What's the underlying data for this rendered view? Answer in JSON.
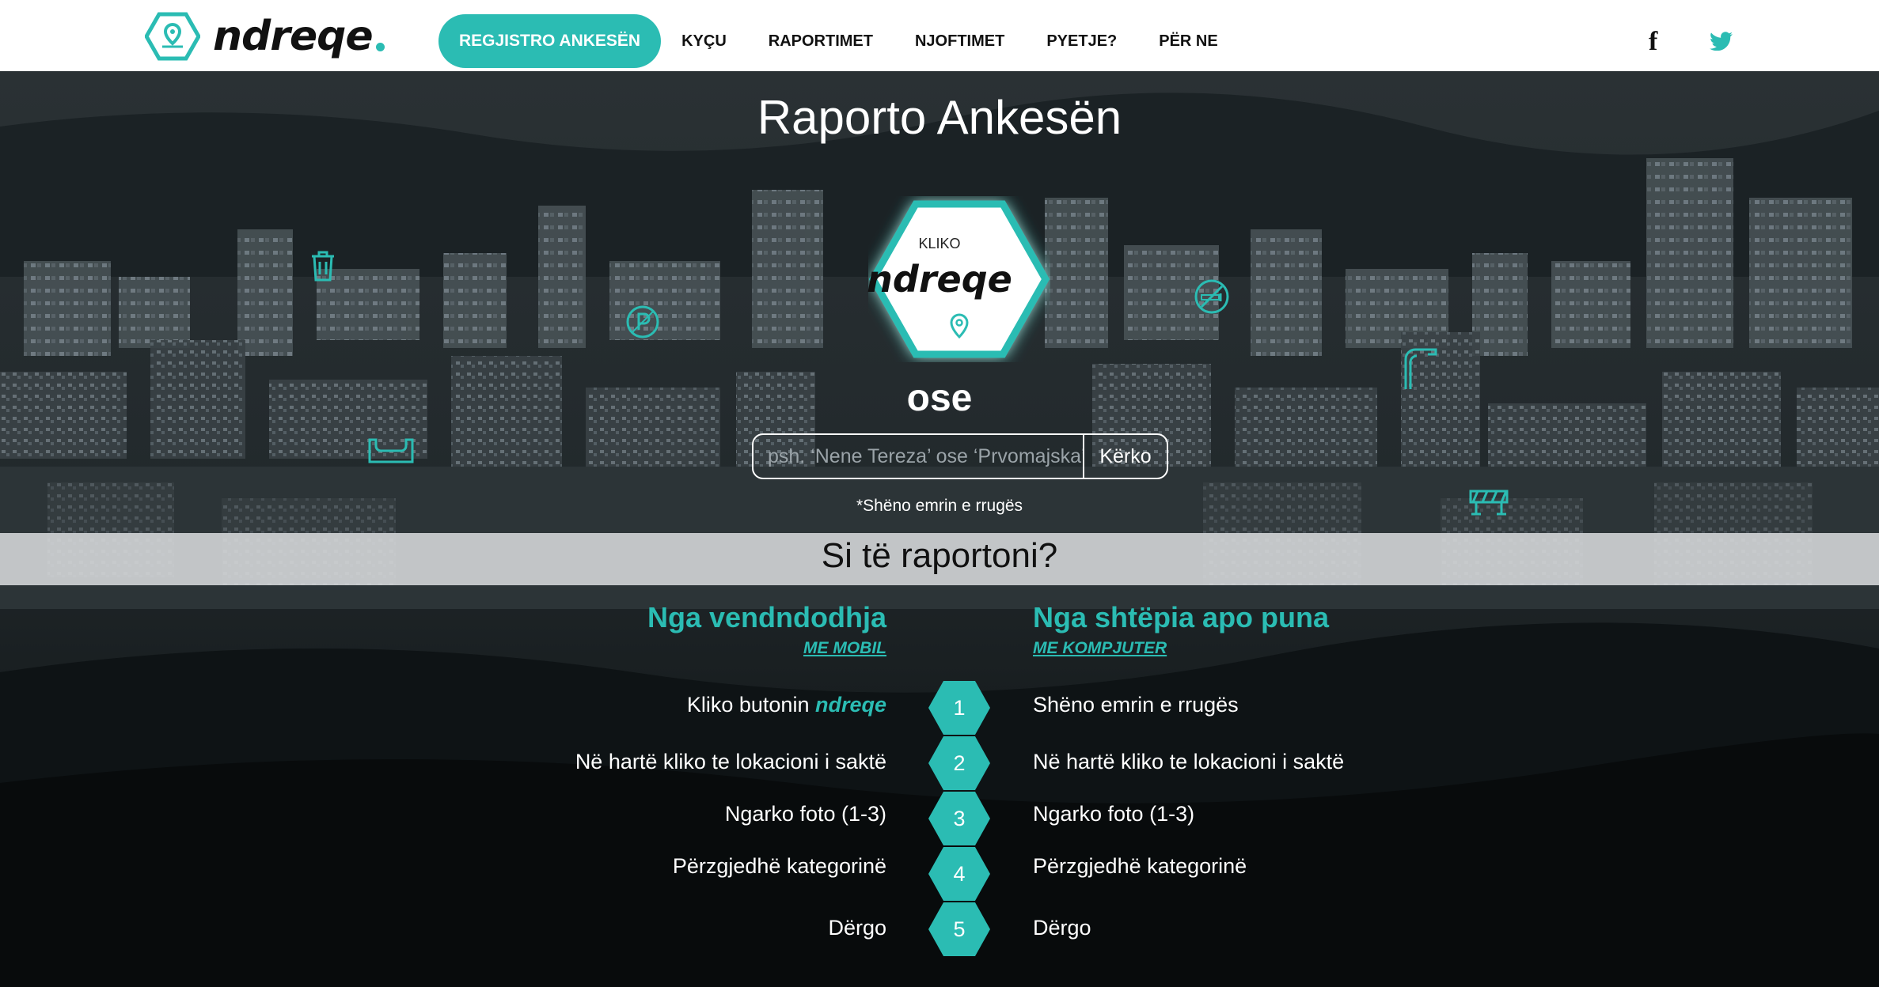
{
  "brand": {
    "name": "ndreqe",
    "accent": "#2bbcb3"
  },
  "nav": {
    "primary_label": "REGJISTRO ANKESËN",
    "items": [
      "KYÇU",
      "RAPORTIMET",
      "NJOFTIMET",
      "PYETJE?",
      "PËR NE"
    ]
  },
  "social": {
    "facebook": "f",
    "facebook_icon": "facebook-icon",
    "twitter_icon": "twitter-icon"
  },
  "hero": {
    "title": "Raporto Ankesën",
    "button_top": "KLIKO",
    "button_word": "ndreqe",
    "or_text": "ose",
    "search_placeholder": "psh. ‘Nene Tereza’ ose ‘Prvomajska’",
    "search_button": "Kërko",
    "hint": "*Shëno emrin e rrugës"
  },
  "how": {
    "title": "Si të raportoni?",
    "left": {
      "heading": "Nga vendndodhja",
      "sub": "ME MOBIL",
      "step1_prefix": "Kliko butonin ",
      "step1_em": "ndreqe",
      "steps": [
        "Në hartë kliko te lokacioni i saktë",
        "Ngarko foto (1-3)",
        "Përzgjedhë kategorinë",
        "Dërgo"
      ]
    },
    "right": {
      "heading": "Nga shtëpia apo puna",
      "sub": "ME KOMPJUTER",
      "steps": [
        "Shëno emrin e rrugës",
        "Në hartë kliko te lokacioni i saktë",
        "Ngarko foto (1-3)",
        "Përzgjedhë kategorinë",
        "Dërgo"
      ]
    },
    "numbers": [
      "1",
      "2",
      "3",
      "4",
      "5"
    ]
  },
  "icons": [
    "trash-icon",
    "parking-icon",
    "pothole-icon",
    "no-smoking-icon",
    "streetlight-icon",
    "roadblock-icon",
    "location-pin-icon"
  ]
}
